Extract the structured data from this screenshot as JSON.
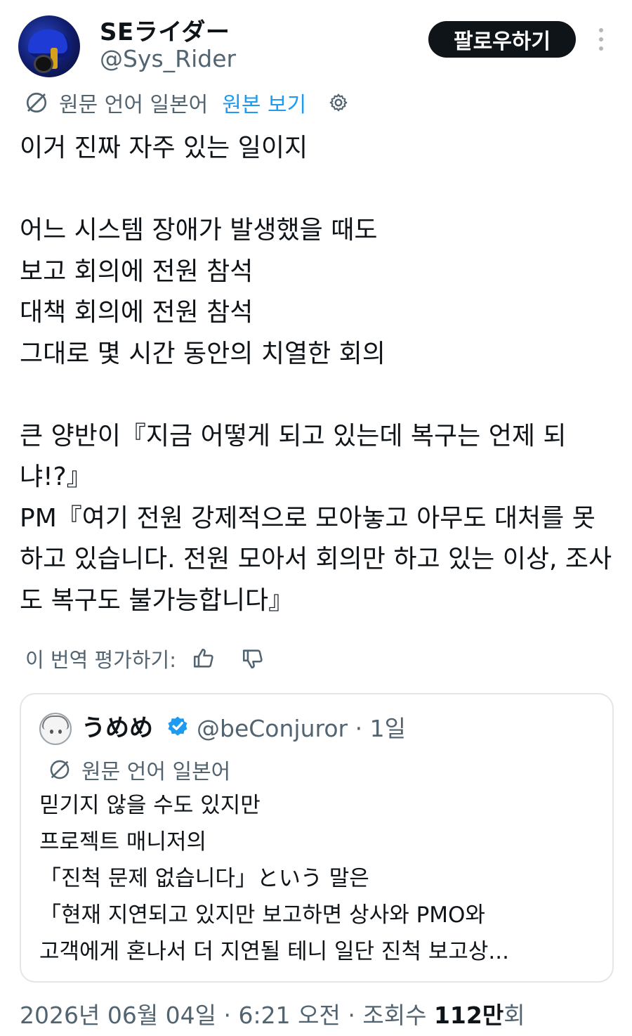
{
  "author": {
    "display_name": "SEライダー",
    "handle": "@Sys_Rider",
    "follow_label": "팔로우하기"
  },
  "translation": {
    "source_language": "원문 언어 일본어",
    "show_original": "원본 보기"
  },
  "tweet": {
    "text": "이거 진짜 자주 있는 일이지\n\n어느 시스템 장애가 발생했을 때도\n보고 회의에 전원 참석\n대책 회의에 전원 참석\n그대로 몇 시간 동안의 치열한 회의\n\n큰 양반이『지금 어떻게 되고 있는데 복구는 언제 되냐!?』\nPM『여기 전원 강제적으로 모아놓고 아무도 대처를 못 하고 있습니다. 전원 모아서 회의만 하고 있는 이상, 조사도 복구도 불가능합니다』"
  },
  "rating": {
    "label": "이 번역 평가하기:"
  },
  "quote": {
    "display_name": "うめめ",
    "handle": "@beConjuror",
    "separator": "·",
    "time": "1일",
    "source_language": "원문 언어 일본어",
    "text": "믿기지 않을 수도 있지만\n프로젝트 매니저의\n「진척 문제 없습니다」という 말은\n「현재 지연되고 있지만 보고하면 상사와 PMO와\n고객에게 혼나서 더 지연될 테니 일단 진척 보고상..."
  },
  "footer": {
    "date": "2026년 06월 04일",
    "sep1": "·",
    "time": "6:21 오전",
    "sep2": "·",
    "views_label": "조회수",
    "views_value": "112만",
    "views_suffix": "회"
  },
  "colors": {
    "text": "#0f1419",
    "secondary": "#536471",
    "link": "#1d9bf0",
    "verified": "#1d9bf0",
    "button_bg": "#0f1419",
    "border": "#e1e6ea"
  },
  "icons": [
    "avatar",
    "more-icon",
    "translate-icon",
    "gear-icon",
    "thumbs-up-icon",
    "thumbs-down-icon",
    "verified-badge-icon"
  ]
}
